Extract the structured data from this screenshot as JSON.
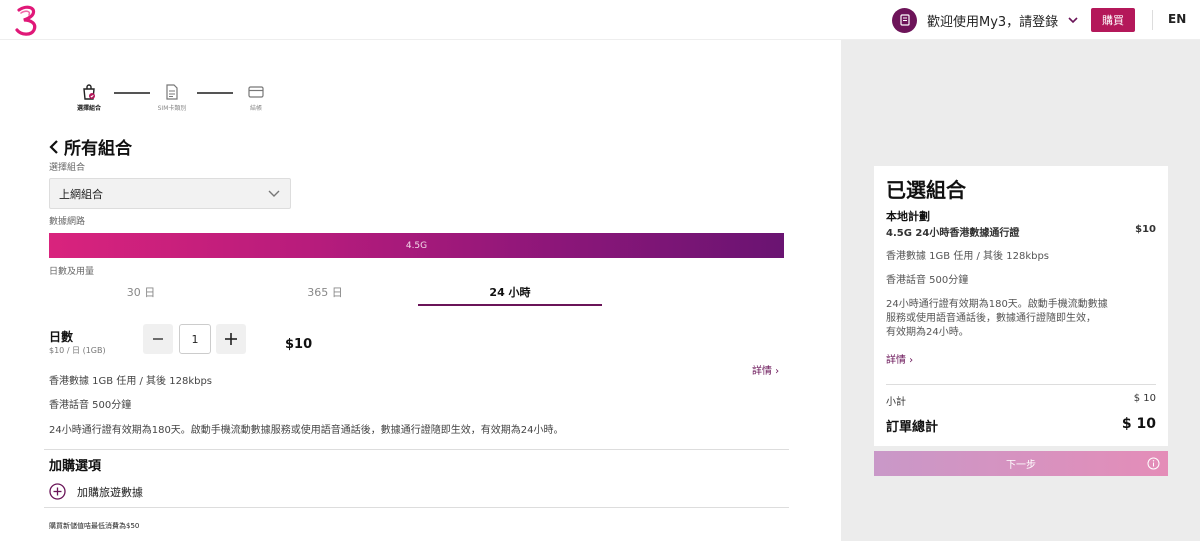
{
  "header": {
    "logo_icon": "three-logo-icon",
    "welcome_text": "歡迎使用My3，請登錄",
    "buy_label": "購買",
    "lang_label": "EN",
    "brand_color": "#b4185a"
  },
  "steps": [
    {
      "label": "選擇組合",
      "icon": "bag-icon",
      "active": true
    },
    {
      "label": "SIM卡類別",
      "icon": "document-icon",
      "active": false
    },
    {
      "label": "結帳",
      "icon": "card-icon",
      "active": false
    }
  ],
  "main": {
    "back_title": "所有組合",
    "select_label": "選擇組合",
    "select_value": "上網組合",
    "network_label": "數據網路",
    "network_value": "4.5G",
    "duration_label": "日數及用量",
    "tabs": [
      {
        "label": "30 日",
        "active": false
      },
      {
        "label": "365 日",
        "active": false
      },
      {
        "label": "24 小時",
        "active": true
      }
    ],
    "days_label": "日數",
    "days_sub": "$10 / 日 (1GB)",
    "quantity": "1",
    "price": "$10",
    "detail_link": "詳情 ›",
    "lines": [
      "香港數據 1GB 任用 / 其後 128kbps",
      "香港話音 500分鐘",
      "24小時通行證有效期為180天。啟動手機流動數據服務或使用語音通話後，數據通行證隨即生效，有效期為24小時。"
    ],
    "addon_title": "加購選項",
    "addon_item": "加購旅遊數據",
    "footer_note": "購買新儲值咭最低消費為$50"
  },
  "summary": {
    "title": "已選組合",
    "subtitle": "本地計劃",
    "plan_name": "4.5G 24小時香港數據通行證",
    "plan_price": "$10",
    "lines": [
      "香港數據 1GB 任用 / 其後 128kbps",
      "香港話音 500分鐘",
      "24小時通行證有效期為180天。啟動手機流動數據",
      "服務或使用語音通話後，數據通行證隨即生效，",
      "有效期為24小時。"
    ],
    "detail_link": "詳情 ›",
    "subtotal_label": "小計",
    "subtotal_value": "$ 10",
    "total_label": "訂單總計",
    "total_value": "$ 10",
    "next_label": "下一步"
  }
}
